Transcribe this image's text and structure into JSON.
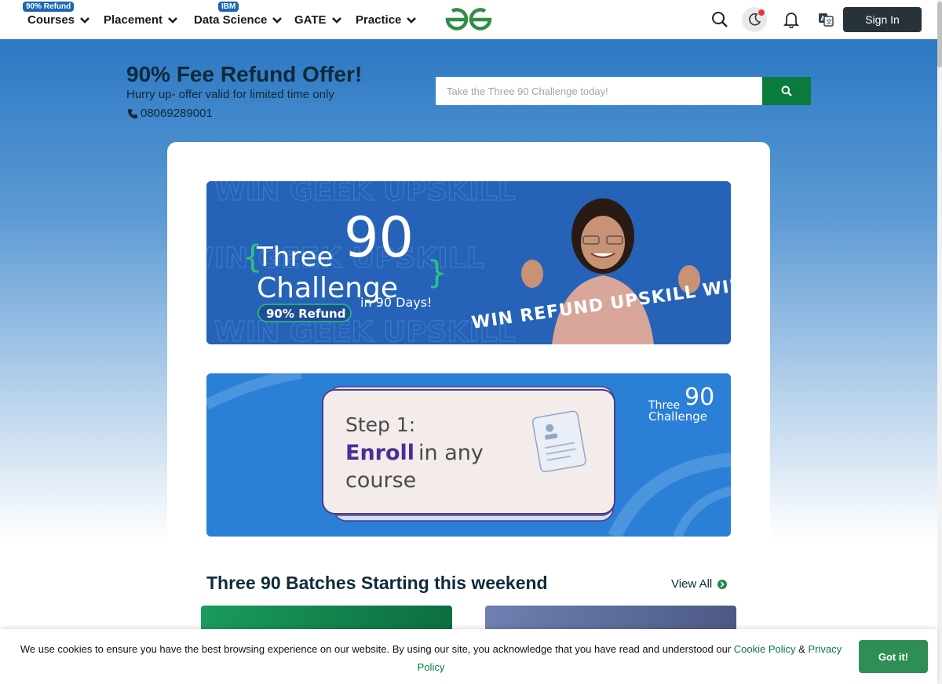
{
  "nav": {
    "items": [
      {
        "label": "Courses",
        "badge": "90% Refund"
      },
      {
        "label": "Placement",
        "badge": ""
      },
      {
        "label": "Data Science",
        "badge": "IBM"
      },
      {
        "label": "GATE",
        "badge": ""
      },
      {
        "label": "Practice",
        "badge": ""
      }
    ],
    "sign_in": "Sign In",
    "icons": [
      "search-icon",
      "moon-icon",
      "bell-icon",
      "translate-icon"
    ]
  },
  "offer": {
    "title": "90% Fee Refund Offer!",
    "subtitle": "Hurry up- offer valid for limited time only",
    "phone": "08069289001"
  },
  "search": {
    "placeholder": "Take the Three 90 Challenge today!"
  },
  "banner1": {
    "three": "Three",
    "ninety": "90",
    "challenge": "Challenge",
    "refund": "90% Refund",
    "days": "in 90 Days!",
    "ribbon": "WIN REFUND UPSKILL WIN",
    "bg_words": "WIN GEEK UPSKILL"
  },
  "banner2": {
    "step": "Step 1:",
    "enroll": "Enroll",
    "in_any": "in any",
    "course": "course",
    "corner_three": "Three",
    "corner_ninety": "90",
    "corner_challenge": "Challenge"
  },
  "batches": {
    "title": "Three 90 Batches Starting this weekend",
    "view_all": "View All"
  },
  "cookie": {
    "text": "We use cookies to ensure you have the best browsing experience on our website. By using our site, you acknowledge that you have read and understood our",
    "cookie_policy": "Cookie Policy",
    "amp": "&",
    "privacy_policy": "Privacy Policy",
    "button": "Got it!"
  },
  "colors": {
    "brand_green": "#0a7a3d",
    "hero_blue": "#2b78c3",
    "badge_blue": "#1b67b4",
    "signin_dark": "#283339"
  }
}
